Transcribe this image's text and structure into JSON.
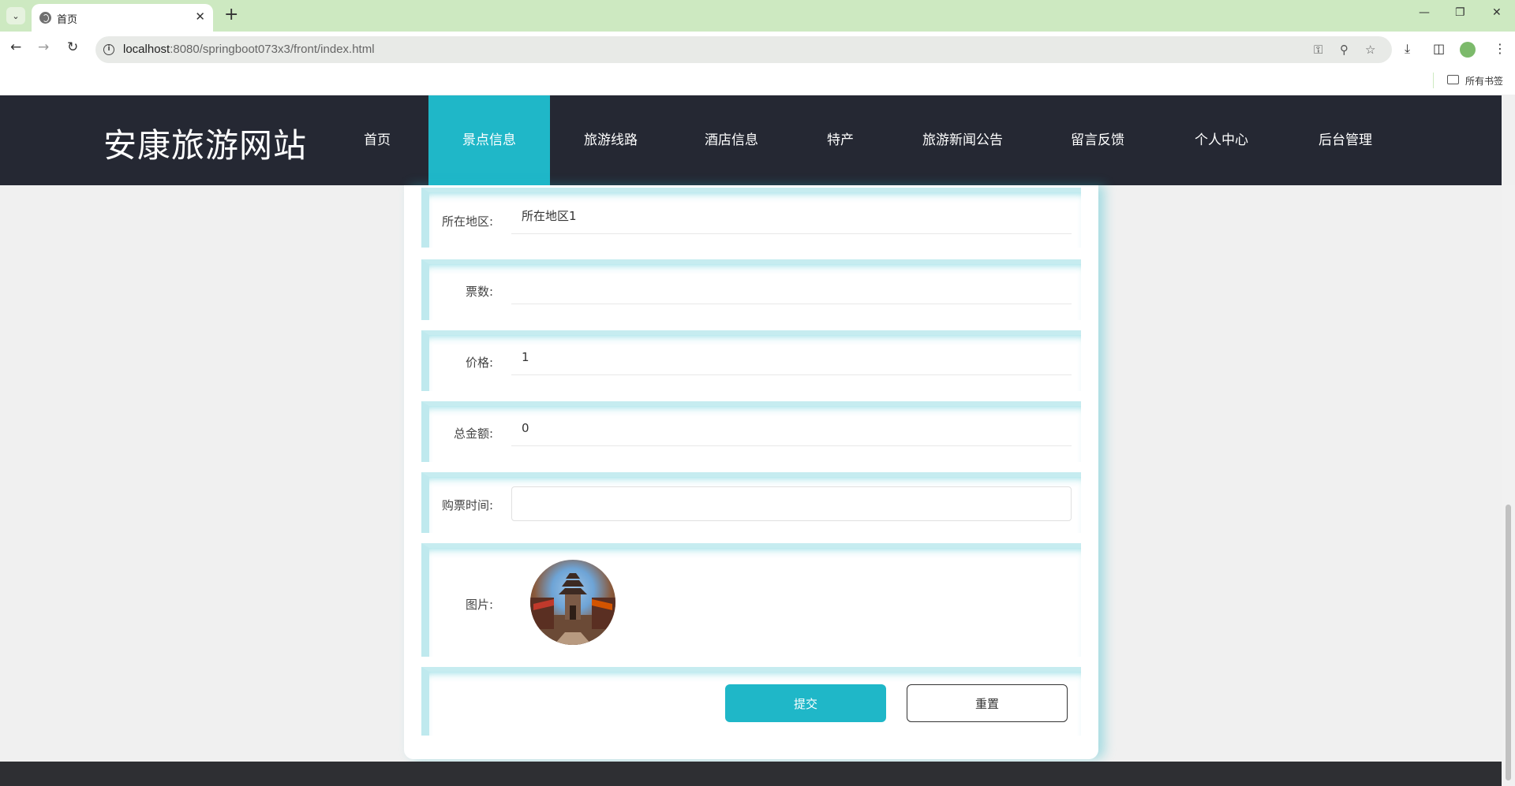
{
  "browser": {
    "tab_title": "首页",
    "url_host": "localhost",
    "url_rest": ":8080/springboot073x3/front/index.html",
    "bookmarks_label": "所有书签"
  },
  "site": {
    "title": "安康旅游网站",
    "nav": [
      {
        "label": "首页"
      },
      {
        "label": "景点信息",
        "active": true
      },
      {
        "label": "旅游线路"
      },
      {
        "label": "酒店信息"
      },
      {
        "label": "特产"
      },
      {
        "label": "旅游新闻公告"
      },
      {
        "label": "留言反馈"
      },
      {
        "label": "个人中心"
      },
      {
        "label": "后台管理"
      }
    ]
  },
  "form": {
    "region": {
      "label": "所在地区:",
      "value": "所在地区1"
    },
    "tickets": {
      "label": "票数:",
      "value": ""
    },
    "price": {
      "label": "价格:",
      "value": "1"
    },
    "total": {
      "label": "总金额:",
      "value": "0"
    },
    "purchase_time": {
      "label": "购票时间:",
      "value": ""
    },
    "image": {
      "label": "图片:"
    },
    "submit_label": "提交",
    "reset_label": "重置"
  },
  "colors": {
    "accent": "#1fb7c8",
    "header_bg": "#252833",
    "tabstrip_bg": "#cde9c1"
  }
}
